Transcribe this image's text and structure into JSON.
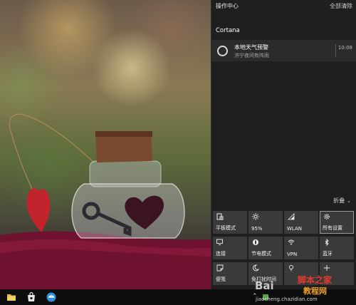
{
  "action_center": {
    "title": "操作中心",
    "clear_all": "全部清除",
    "group": "Cortana",
    "notification": {
      "title": "本地天气预警",
      "body": "济宁夜间有阵雨",
      "time": "10:08",
      "icon": "cortana-ring-icon"
    },
    "collapse_label": "折叠",
    "tiles": [
      {
        "label": "平板模式",
        "icon": "tablet-mode-icon"
      },
      {
        "label": "95%",
        "icon": "brightness-icon"
      },
      {
        "label": "WLAN",
        "icon": "wifi-icon"
      },
      {
        "label": "所有设置",
        "icon": "gear-icon"
      },
      {
        "label": "连接",
        "icon": "connect-icon"
      },
      {
        "label": "节电模式",
        "icon": "battery-saver-icon"
      },
      {
        "label": "VPN",
        "icon": "vpn-icon"
      },
      {
        "label": "蓝牙",
        "icon": "bluetooth-icon"
      },
      {
        "label": "便笺",
        "icon": "note-icon"
      },
      {
        "label": "免打扰时间",
        "icon": "moon-icon"
      },
      {
        "label": "",
        "icon": "location-icon"
      },
      {
        "label": "",
        "icon": "project-icon"
      }
    ]
  },
  "taskbar": {
    "pinned": [
      "file-explorer-icon",
      "store-icon",
      "edge-icon"
    ]
  },
  "watermark": {
    "baidu": "Bai",
    "site_line1": "脚本之家",
    "site_line2": "教程网",
    "url": "jiaocheng.chazidian.com"
  },
  "colors": {
    "panel_bg": "#1f1f1f",
    "tile_bg": "#3a3a3a",
    "taskbar_bg": "#0d0d0d"
  }
}
